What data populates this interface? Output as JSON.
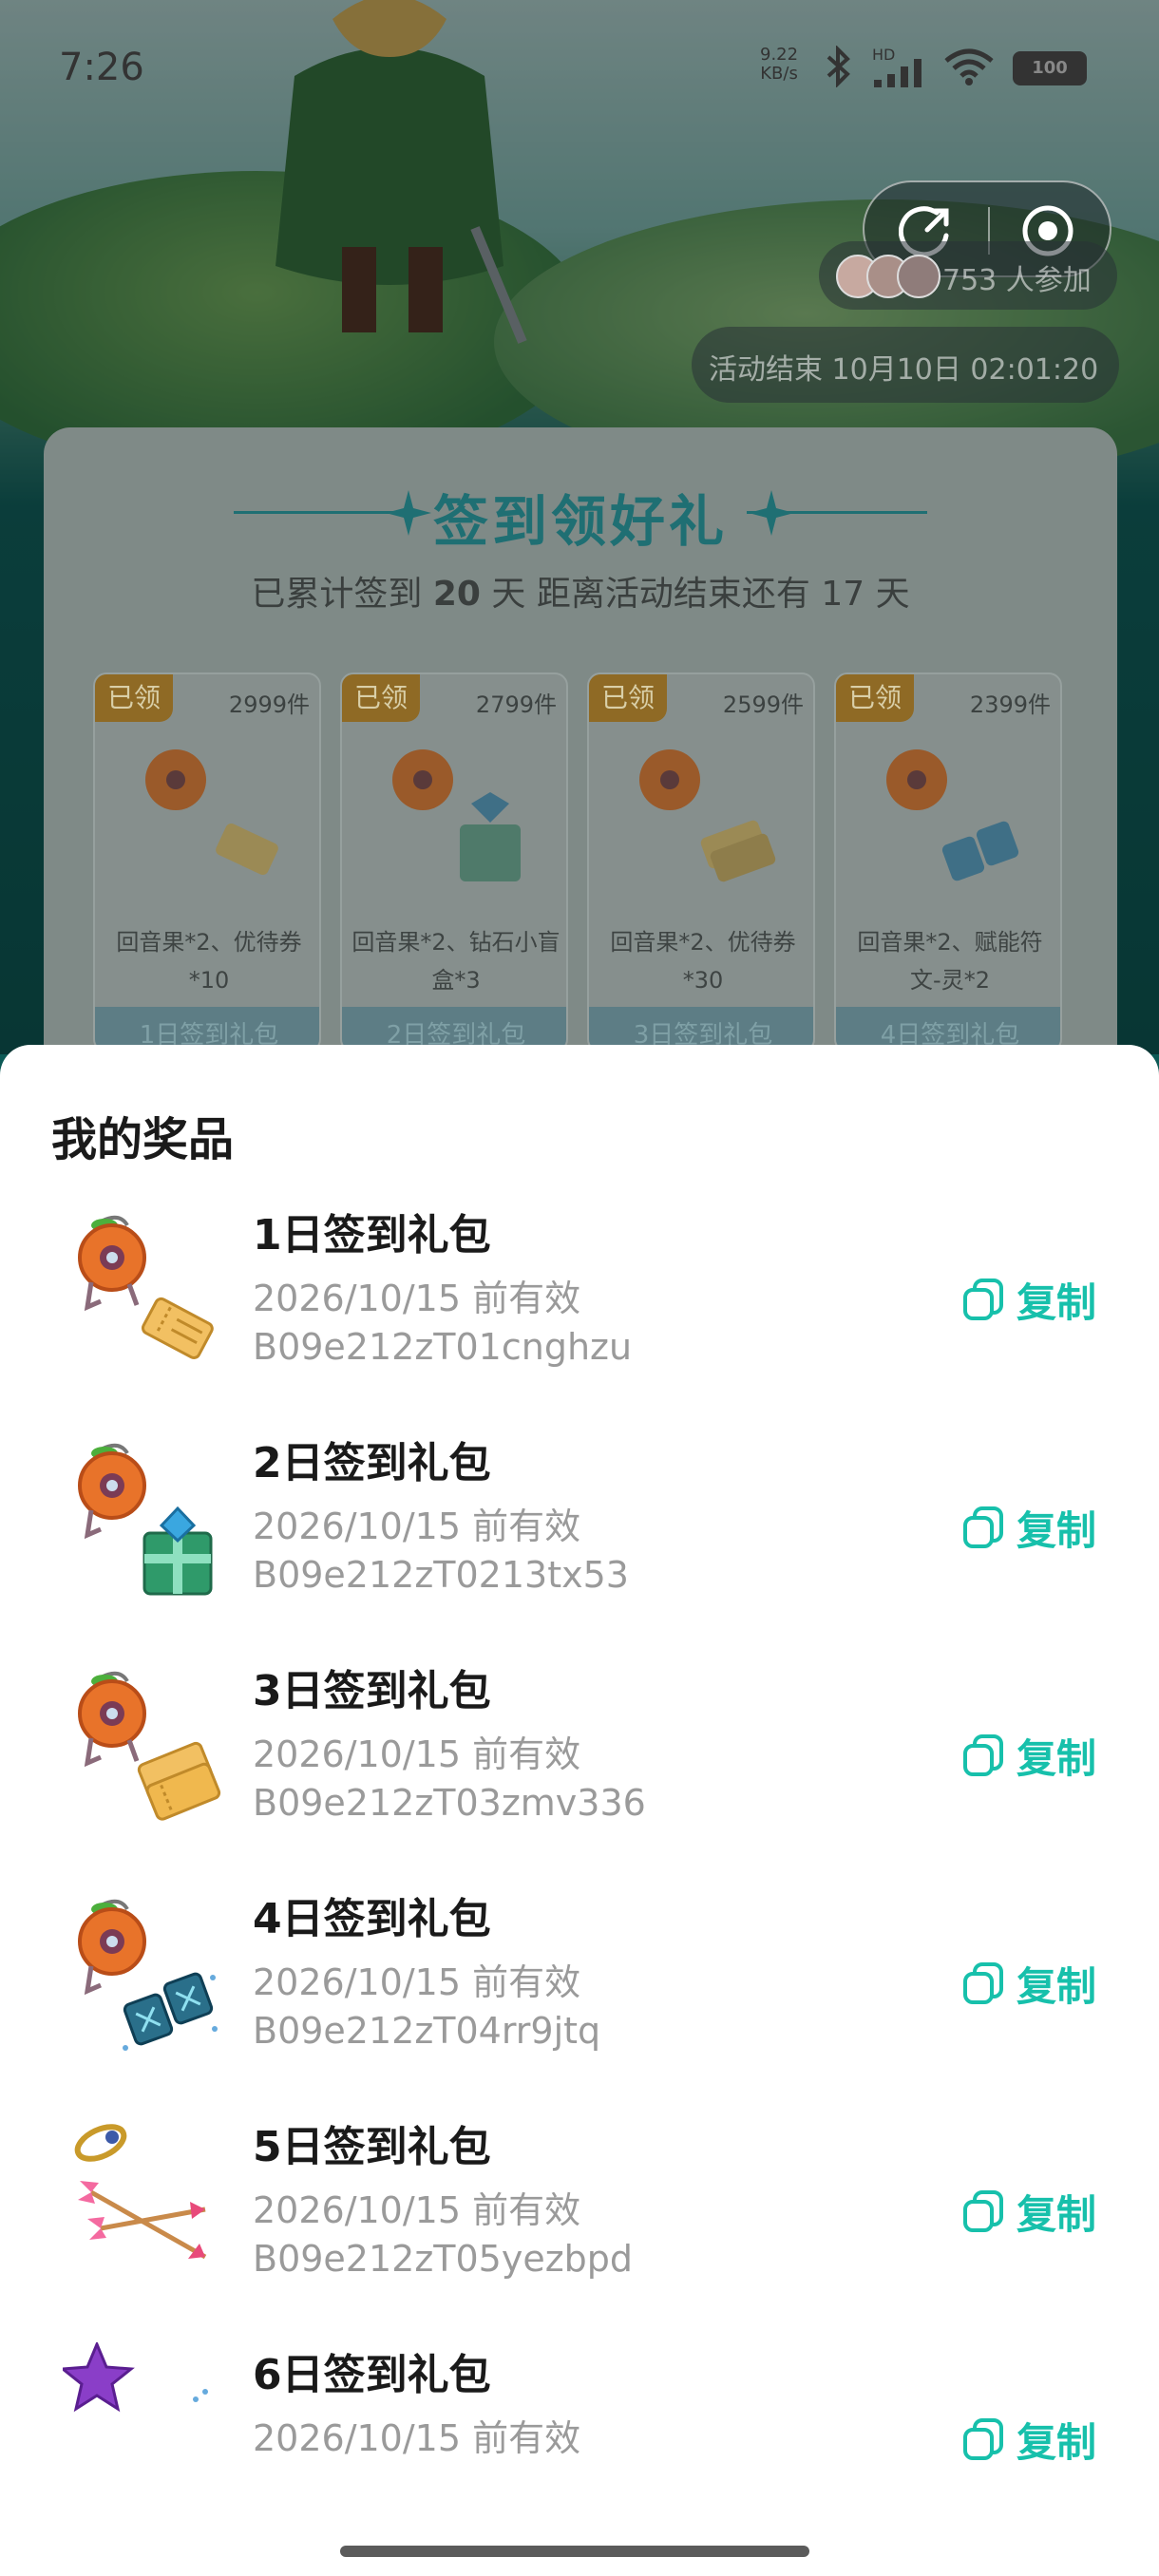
{
  "status_bar": {
    "time": "7:26",
    "net_speed": "9.22",
    "net_unit": "KB/s",
    "network_label": "HD",
    "battery": "100"
  },
  "header": {
    "participants_text": "753 人参加",
    "countdown_text": "活动结束 10月10日 02:01:20"
  },
  "checkin": {
    "title": "签到领好礼",
    "summary_prefix": "已累计签到",
    "days_signed": "20",
    "summary_mid": "天  距离活动结束还有",
    "days_left": "17",
    "summary_suffix": "天",
    "cards": [
      {
        "badge": "已领",
        "stock": "2999件",
        "desc": "回音果*2、优待券*10",
        "button": "1日签到礼包"
      },
      {
        "badge": "已领",
        "stock": "2799件",
        "desc": "回音果*2、钻石小盲盒*3",
        "button": "2日签到礼包"
      },
      {
        "badge": "已领",
        "stock": "2599件",
        "desc": "回音果*2、优待券*30",
        "button": "3日签到礼包"
      },
      {
        "badge": "已领",
        "stock": "2399件",
        "desc": "回音果*2、赋能符文-灵*2",
        "button": "4日签到礼包"
      }
    ]
  },
  "prizes_sheet": {
    "title": "我的奖品",
    "copy_label": "复制",
    "items": [
      {
        "name": "1日签到礼包",
        "expire": "2026/10/15 前有效",
        "code": "B09e212zT01cnghzu",
        "icon": "apple-ticket-icon"
      },
      {
        "name": "2日签到礼包",
        "expire": "2026/10/15 前有效",
        "code": "B09e212zT0213tx53",
        "icon": "apple-giftbox-icon"
      },
      {
        "name": "3日签到礼包",
        "expire": "2026/10/15 前有效",
        "code": "B09e212zT03zmv336",
        "icon": "apple-tickets-icon"
      },
      {
        "name": "4日签到礼包",
        "expire": "2026/10/15 前有效",
        "code": "B09e212zT04rr9jtq",
        "icon": "apple-rune-icon"
      },
      {
        "name": "5日签到礼包",
        "expire": "2026/10/15 前有效",
        "code": "B09e212zT05yezbpd",
        "icon": "ring-arrows-icon"
      },
      {
        "name": "6日签到礼包",
        "expire": "2026/10/15 前有效",
        "code": "",
        "icon": "star-gem-icon"
      }
    ]
  },
  "colors": {
    "accent": "#17c0ab",
    "title_teal": "#1f6f73",
    "badge_gold": "#d89a2a"
  }
}
